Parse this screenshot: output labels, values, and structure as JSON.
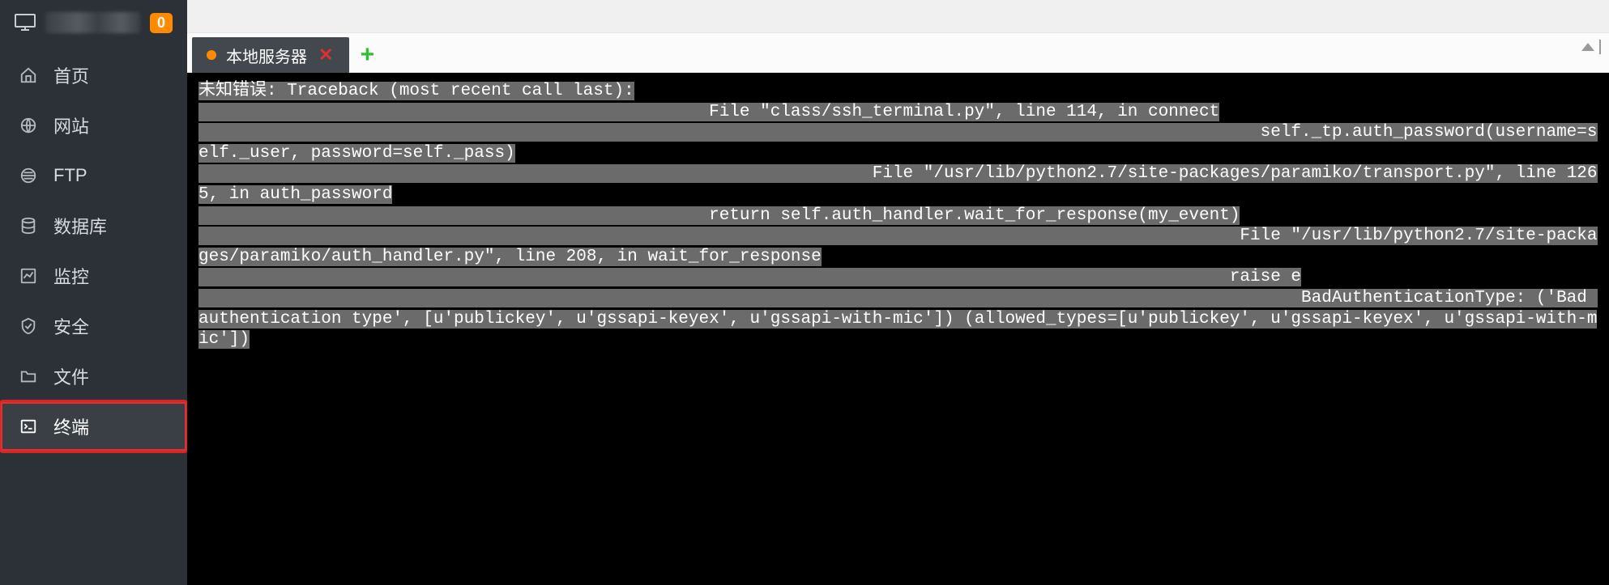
{
  "header": {
    "badge": "0"
  },
  "sidebar": {
    "items": [
      {
        "id": "home",
        "label": "首页",
        "icon": "home-icon"
      },
      {
        "id": "site",
        "label": "网站",
        "icon": "globe-icon"
      },
      {
        "id": "ftp",
        "label": "FTP",
        "icon": "ftp-icon"
      },
      {
        "id": "database",
        "label": "数据库",
        "icon": "database-icon"
      },
      {
        "id": "monitor",
        "label": "监控",
        "icon": "monitor-icon"
      },
      {
        "id": "security",
        "label": "安全",
        "icon": "shield-icon"
      },
      {
        "id": "files",
        "label": "文件",
        "icon": "folder-icon"
      },
      {
        "id": "terminal",
        "label": "终端",
        "icon": "terminal-icon",
        "active": true
      }
    ]
  },
  "tabs": {
    "active": {
      "label": "本地服务器"
    }
  },
  "terminal": {
    "text": "未知错误: Traceback (most recent call last):\n                                                  File \"class/ssh_terminal.py\", line 114, in connect\n                                                                                                        self._tp.auth_password(username=self._user, password=self._pass)\n                                                                  File \"/usr/lib/python2.7/site-packages/paramiko/transport.py\", line 1265, in auth_password\n                                                  return self.auth_handler.wait_for_response(my_event)\n                                                                                                      File \"/usr/lib/python2.7/site-packages/paramiko/auth_handler.py\", line 208, in wait_for_response\n                                                                                                     raise e\n                                                                                                            BadAuthenticationType: ('Bad authentication type', [u'publickey', u'gssapi-keyex', u'gssapi-with-mic']) (allowed_types=[u'publickey', u'gssapi-keyex', u'gssapi-with-mic'])"
  }
}
